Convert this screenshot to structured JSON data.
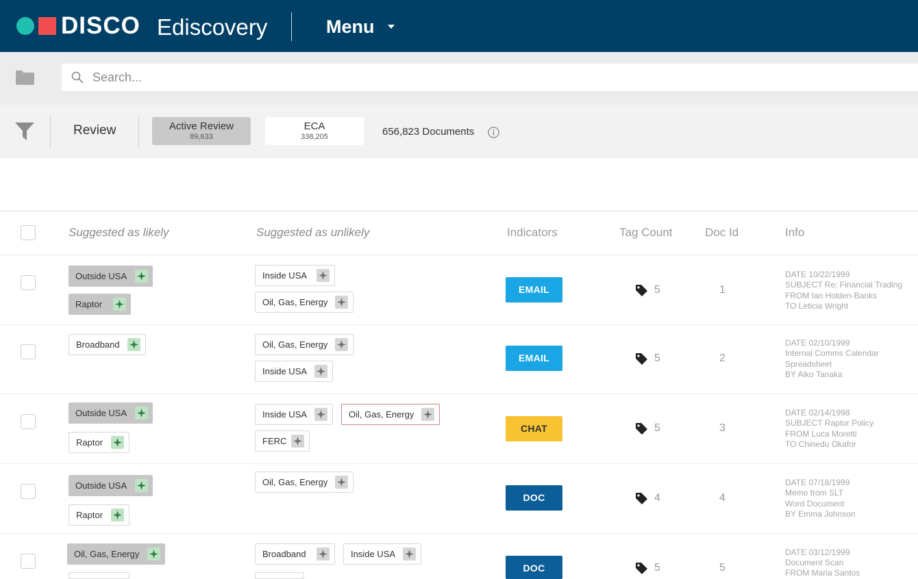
{
  "header": {
    "brand": "DISCO",
    "product": "Ediscovery",
    "menu_label": "Menu"
  },
  "search": {
    "placeholder": "Search..."
  },
  "filters": {
    "review_label": "Review",
    "active_review": {
      "label": "Active Review",
      "count": "89,633"
    },
    "eca": {
      "label": "ECA",
      "count": "338,205"
    },
    "document_count": "656,823 Documents"
  },
  "table": {
    "columns": {
      "likely": "Suggested as likely",
      "unlikely": "Suggested as unlikely",
      "indicators": "Indicators",
      "tag_count": "Tag Count",
      "doc_id": "Doc Id",
      "info": "Info"
    },
    "rows": [
      {
        "likely": [
          "Outside USA",
          "Raptor"
        ],
        "unlikely": [
          "Inside USA",
          "Oil, Gas, Energy"
        ],
        "indicator": "EMAIL",
        "tag_count": "5",
        "doc_id": "1",
        "info": [
          "DATE 10/22/1999",
          "SUBJECT Re: Financial Trading",
          "FROM Ian Holden-Banks",
          "TO Leticia Wright"
        ]
      },
      {
        "likely": [
          "Broadband"
        ],
        "unlikely": [
          "Oil, Gas, Energy",
          "Inside USA"
        ],
        "indicator": "EMAIL",
        "tag_count": "5",
        "doc_id": "2",
        "info": [
          "DATE 02/10/1999",
          "Internal Comms Calendar",
          "Spreadsheet",
          "BY Aiko Tanaka"
        ]
      },
      {
        "likely": [
          "Outside USA",
          "Raptor"
        ],
        "unlikely": [
          "Inside USA",
          "Oil, Gas, Energy",
          "FERC"
        ],
        "indicator": "CHAT",
        "tag_count": "5",
        "doc_id": "3",
        "info": [
          "DATE 02/14/1998",
          "SUBJECT Raptor Policy",
          "FROM Luca Moretti",
          "TO Chinedu Okafor"
        ]
      },
      {
        "likely": [
          "Outside USA",
          "Raptor"
        ],
        "unlikely": [
          "Oil, Gas, Energy"
        ],
        "indicator": "DOC",
        "tag_count": "4",
        "doc_id": "4",
        "info": [
          "DATE 07/18/1999",
          "Memo from SLT",
          "Word Document",
          "BY Emma Johnson"
        ]
      },
      {
        "likely": [
          "Oil, Gas, Energy"
        ],
        "unlikely": [
          "Broadband",
          "Inside USA"
        ],
        "indicator": "DOC",
        "tag_count": "5",
        "doc_id": "5",
        "info": [
          "DATE 03/12/1999",
          "Document Scan",
          "FROM Maria Santos"
        ]
      }
    ]
  },
  "colors": {
    "header_bg": "#004066",
    "email": "#1aa6e4",
    "chat": "#f8c332",
    "doc": "#0c5e99",
    "tag_star_green": "#bfe3c4"
  }
}
